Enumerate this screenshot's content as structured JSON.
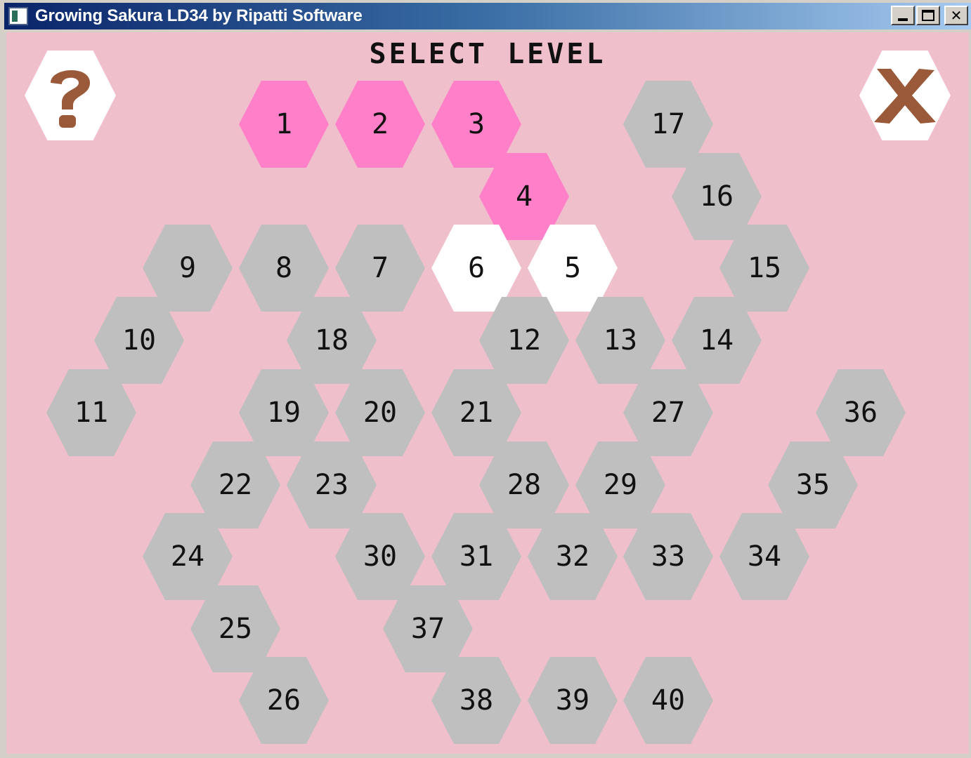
{
  "window": {
    "title": "Growing Sakura LD34 by Ripatti Software",
    "buttons": [
      "minimize",
      "maximize",
      "close"
    ]
  },
  "screen": {
    "title": "SELECT LEVEL",
    "help_icon": "question-mark-icon",
    "close_icon": "x-icon"
  },
  "colors": {
    "background": "#f0bfcc",
    "completed": "#ff80c8",
    "available": "#ffffff",
    "locked": "#bfbfbf",
    "icon": "#9a5a3a"
  },
  "levels": [
    {
      "label": "1",
      "state": "completed"
    },
    {
      "label": "2",
      "state": "completed"
    },
    {
      "label": "3",
      "state": "completed"
    },
    {
      "label": "4",
      "state": "completed"
    },
    {
      "label": "5",
      "state": "available"
    },
    {
      "label": "6",
      "state": "available"
    },
    {
      "label": "7",
      "state": "locked"
    },
    {
      "label": "8",
      "state": "locked"
    },
    {
      "label": "9",
      "state": "locked"
    },
    {
      "label": "10",
      "state": "locked"
    },
    {
      "label": "11",
      "state": "locked"
    },
    {
      "label": "12",
      "state": "locked"
    },
    {
      "label": "13",
      "state": "locked"
    },
    {
      "label": "14",
      "state": "locked"
    },
    {
      "label": "15",
      "state": "locked"
    },
    {
      "label": "16",
      "state": "locked"
    },
    {
      "label": "17",
      "state": "locked"
    },
    {
      "label": "18",
      "state": "locked"
    },
    {
      "label": "19",
      "state": "locked"
    },
    {
      "label": "20",
      "state": "locked"
    },
    {
      "label": "21",
      "state": "locked"
    },
    {
      "label": "22",
      "state": "locked"
    },
    {
      "label": "23",
      "state": "locked"
    },
    {
      "label": "24",
      "state": "locked"
    },
    {
      "label": "25",
      "state": "locked"
    },
    {
      "label": "26",
      "state": "locked"
    },
    {
      "label": "27",
      "state": "locked"
    },
    {
      "label": "28",
      "state": "locked"
    },
    {
      "label": "29",
      "state": "locked"
    },
    {
      "label": "30",
      "state": "locked"
    },
    {
      "label": "31",
      "state": "locked"
    },
    {
      "label": "32",
      "state": "locked"
    },
    {
      "label": "33",
      "state": "locked"
    },
    {
      "label": "34",
      "state": "locked"
    },
    {
      "label": "35",
      "state": "locked"
    },
    {
      "label": "36",
      "state": "locked"
    },
    {
      "label": "37",
      "state": "locked"
    },
    {
      "label": "38",
      "state": "locked"
    },
    {
      "label": "39",
      "state": "locked"
    },
    {
      "label": "40",
      "state": "locked"
    }
  ]
}
